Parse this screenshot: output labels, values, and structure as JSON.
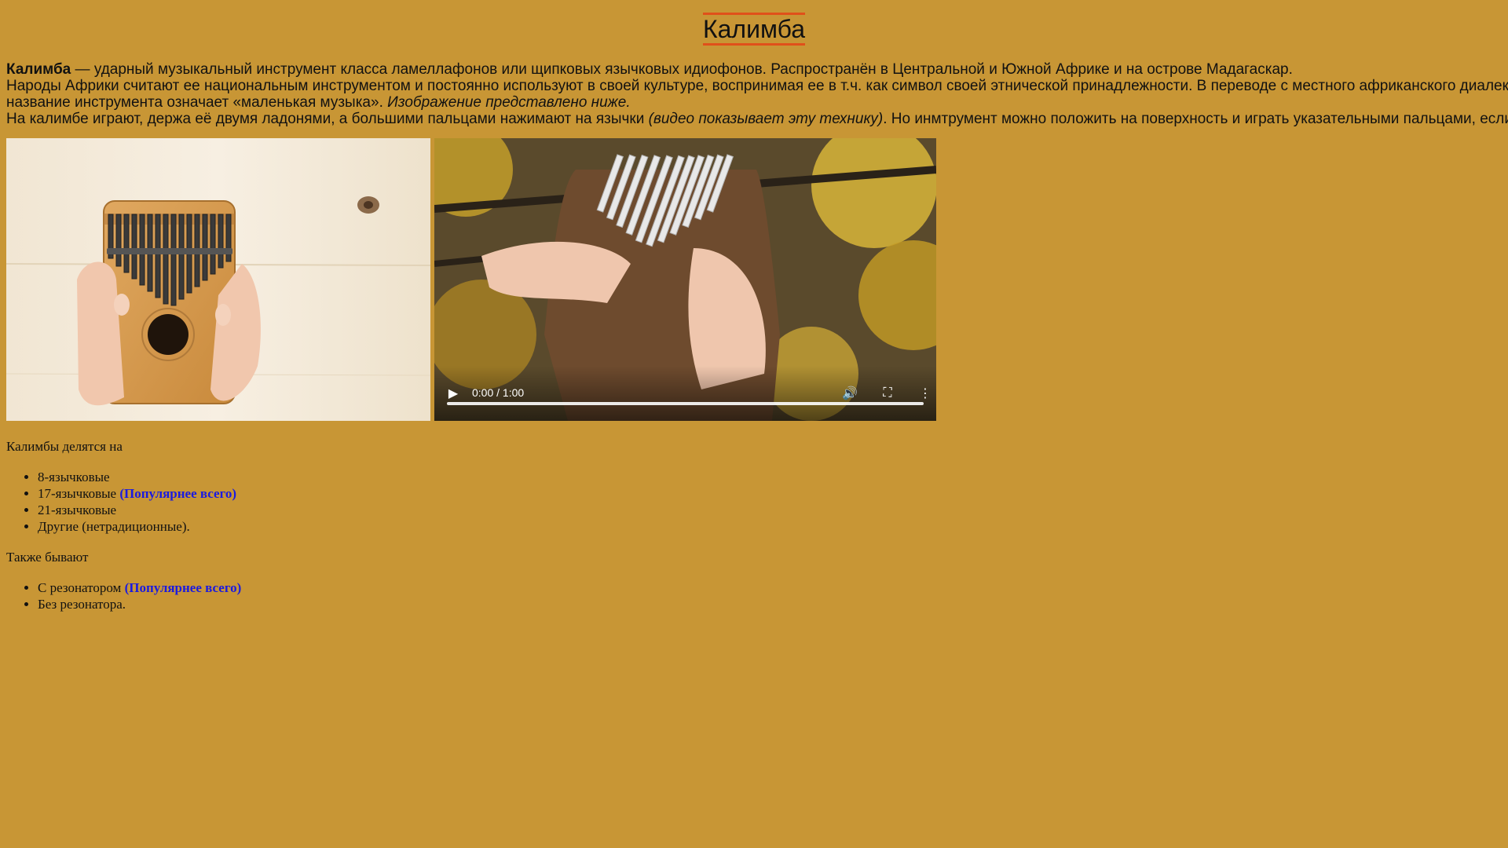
{
  "page": {
    "title": "Калимба",
    "background": "#c89635",
    "title_underline_color": "#e0501a",
    "link_color": "#1a1ae0"
  },
  "intro": {
    "line1_bold": "Калимба",
    "line1_rest": " — ударный музыкальный инструмент класса ламеллафонов или щипковых язычковых идиофонов. Распространён в Центральной и Южной Африке и на острове Мадагаскар.",
    "line2": "Народы Африки считают ее национальным инструментом и постоянно используют в своей культуре, воспринимая ее в т.ч. как символ своей этнической принадлежности. В переводе с местного африканского диалекта,",
    "line3_plain": "название инструмента означает «маленькая музыка». ",
    "line3_italic": "Изображение представлено ниже.",
    "line4_plain": "На калимбе играют, держа её двумя ладонями, а большими пальцами нажимают на язычки ",
    "line4_italic": "(видео показывает эту технику)",
    "line4_rest": ". Но инмтрумент можно положить на поверхность и играть указательными пальцами, если удобно."
  },
  "video": {
    "time": "0:00 / 1:00",
    "play_icon": "play-icon",
    "volume_icon": "volume-icon",
    "fullscreen_icon": "fullscreen-icon",
    "more_icon": "more-vertical-icon",
    "progress": 0
  },
  "section1": {
    "heading": "Калимбы делятся на",
    "items": [
      {
        "text": "8-язычковые",
        "tag": ""
      },
      {
        "text": "17-язычковые ",
        "tag": "(Популярнее всего)"
      },
      {
        "text": "21-язычковые",
        "tag": ""
      },
      {
        "text": "Другие (нетрадиционные).",
        "tag": ""
      }
    ]
  },
  "section2": {
    "heading": "Также бывают",
    "items": [
      {
        "text": "С резонатором ",
        "tag": "(Популярнее всего)"
      },
      {
        "text": "Без резонатора.",
        "tag": ""
      }
    ]
  }
}
